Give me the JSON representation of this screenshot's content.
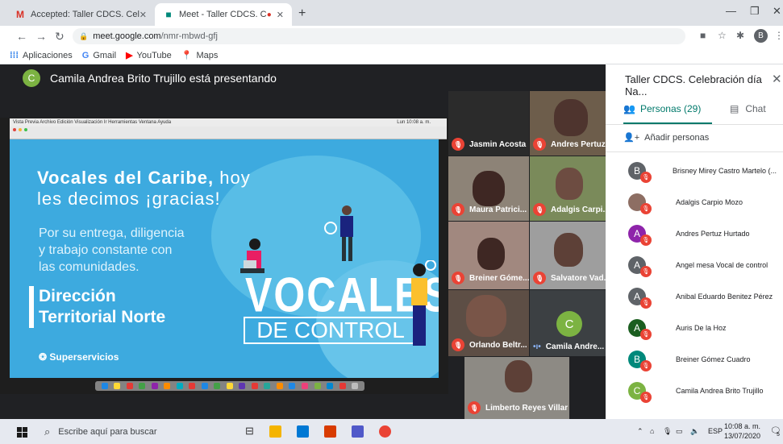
{
  "browser": {
    "tabs": [
      {
        "label": "Accepted: Taller CDCS. Celebraci",
        "icon": "gmail-icon"
      },
      {
        "label": "Meet - Taller CDCS. Celebrac",
        "icon": "meet-icon",
        "active": true
      }
    ],
    "url_host": "meet.google.com",
    "url_path": "/nmr-mbwd-gfj",
    "profile_initial": "B",
    "bookmarks": [
      {
        "label": "Aplicaciones",
        "icon": "apps-icon"
      },
      {
        "label": "Gmail",
        "icon": "google-icon"
      },
      {
        "label": "YouTube",
        "icon": "youtube-icon"
      },
      {
        "label": "Maps",
        "icon": "maps-icon"
      }
    ]
  },
  "meet": {
    "presenter_initial": "C",
    "presenter_text": "Camila Andrea Brito Trujillo está presentando",
    "slide": {
      "title_bold": "Vocales del Caribe,",
      "title_rest": " hoy",
      "title_line2": "les decimos ¡gracias!",
      "body_lines": [
        "Por su entrega, diligencia",
        "y trabajo constante con",
        "las comunidades."
      ],
      "dir_line1": "Dirección",
      "dir_line2": "Territorial Norte",
      "logo_text": "Superservicios",
      "big_word": "VOCALES",
      "big_word2": "DE CONTROL"
    },
    "mac_menu": "Vista Previa  Archivo  Edición  Visualización  Ir  Herramientas  Ventana  Ayuda",
    "mac_clock": "Lun 10:08 a. m.",
    "tiles": [
      {
        "name": "Jasmin Acosta",
        "muted": true
      },
      {
        "name": "Andres Pertuz...",
        "muted": true
      },
      {
        "name": "Maura Patrici...",
        "muted": true
      },
      {
        "name": "Adalgis Carpi...",
        "muted": true
      },
      {
        "name": "Breiner Góme...",
        "muted": true
      },
      {
        "name": "Salvatore Vad...",
        "muted": true
      },
      {
        "name": "Orlando Beltr...",
        "muted": true
      },
      {
        "name": "Camila Andre...",
        "muted": false,
        "initial": "C"
      },
      {
        "name": "Limberto Reyes Villar",
        "muted": true
      }
    ]
  },
  "panel": {
    "title": "Taller CDCS. Celebración día Na...",
    "tab_people": "Personas (29)",
    "tab_chat": "Chat",
    "add_people": "Añadir personas",
    "participants": [
      {
        "initial": "B",
        "name": "Brisney Mirey Castro Martelo (...",
        "color": "#5f6368"
      },
      {
        "initial": "",
        "name": "Adalgis Carpio Mozo",
        "color": "#8d6e63"
      },
      {
        "initial": "A",
        "name": "Andres Pertuz Hurtado",
        "color": "#8e24aa"
      },
      {
        "initial": "A",
        "name": "Angel mesa Vocal de control",
        "color": "#5f6368"
      },
      {
        "initial": "A",
        "name": "Anibal Eduardo Benitez Pérez",
        "color": "#5f6368"
      },
      {
        "initial": "A",
        "name": "Auris De la Hoz",
        "color": "#1b5e20"
      },
      {
        "initial": "B",
        "name": "Breiner Gómez Cuadro",
        "color": "#00897b"
      },
      {
        "initial": "C",
        "name": "Camila Andrea Brito Trujillo",
        "color": "#7cb342"
      }
    ]
  },
  "taskbar": {
    "search_placeholder": "Escribe aquí para buscar",
    "lang": "ESP",
    "time": "10:08 a. m.",
    "date": "13/07/2020",
    "notif_count": "5"
  }
}
